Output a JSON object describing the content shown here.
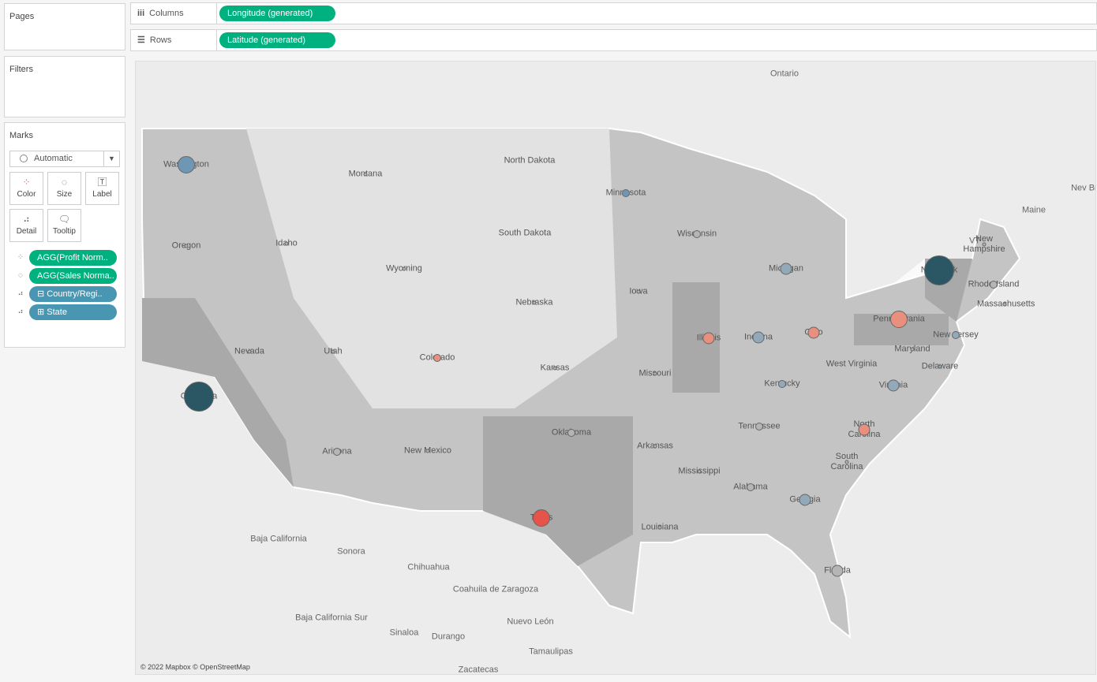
{
  "panels": {
    "pages": "Pages",
    "filters": "Filters",
    "marks": "Marks"
  },
  "shelves": {
    "columns_label": "Columns",
    "columns_pill": "Longitude (generated)",
    "rows_label": "Rows",
    "rows_pill": "Latitude (generated)"
  },
  "marks": {
    "type": "Automatic",
    "buttons": [
      {
        "label": "Color",
        "icon": "color-icon"
      },
      {
        "label": "Size",
        "icon": "size-icon"
      },
      {
        "label": "Label",
        "icon": "label-icon"
      },
      {
        "label": "Detail",
        "icon": "detail-icon"
      },
      {
        "label": "Tooltip",
        "icon": "tooltip-icon"
      }
    ],
    "fields": [
      {
        "label": "AGG(Profit Norm..",
        "kind": "color"
      },
      {
        "label": "AGG(Sales Norma..",
        "kind": "size"
      },
      {
        "label": "⊟ Country/Regi..",
        "kind": "detail"
      },
      {
        "label": "⊞ State",
        "kind": "detail"
      }
    ]
  },
  "map": {
    "attribution": "© 2022 Mapbox © OpenStreetMap",
    "colors": {
      "dark": "#2b5664",
      "blue": "#6f97b3",
      "bluegray": "#92a9ba",
      "gray": "#b5b5b5",
      "salmon": "#e8907d",
      "red": "#e5534b"
    },
    "region_labels": [
      "Ontario",
      "Maine",
      "Nev Brun",
      "VT",
      "Baja California",
      "Sonora",
      "Chihuahua",
      "Coahuila de Zaragoza",
      "Nuevo León",
      "Tamaulipas",
      "Sinaloa",
      "Durango",
      "Zacatecas",
      "Baja California Sur"
    ],
    "states": [
      {
        "name": "Washington",
        "color": "blue",
        "size": "large"
      },
      {
        "name": "Oregon",
        "color": "gray",
        "size": "tiny"
      },
      {
        "name": "Idaho",
        "color": "gray",
        "size": "tiny"
      },
      {
        "name": "Montana",
        "color": "gray",
        "size": "tiny"
      },
      {
        "name": "Wyoming",
        "color": "gray",
        "size": "tiny"
      },
      {
        "name": "Nevada",
        "color": "gray",
        "size": "tiny"
      },
      {
        "name": "Utah",
        "color": "gray",
        "size": "tiny"
      },
      {
        "name": "California",
        "color": "dark",
        "size": "xlarge"
      },
      {
        "name": "Arizona",
        "color": "gray",
        "size": "small"
      },
      {
        "name": "Colorado",
        "color": "salmon",
        "size": "small"
      },
      {
        "name": "New Mexico",
        "color": "gray",
        "size": "tiny"
      },
      {
        "name": "North Dakota"
      },
      {
        "name": "South Dakota"
      },
      {
        "name": "Nebraska",
        "color": "gray",
        "size": "tiny"
      },
      {
        "name": "Kansas",
        "color": "gray",
        "size": "tiny"
      },
      {
        "name": "Oklahoma",
        "color": "gray",
        "size": "small"
      },
      {
        "name": "Texas",
        "color": "red",
        "size": "large"
      },
      {
        "name": "Minnesota",
        "color": "blue",
        "size": "small"
      },
      {
        "name": "Iowa",
        "color": "gray",
        "size": "tiny"
      },
      {
        "name": "Missouri",
        "color": "gray",
        "size": "tiny"
      },
      {
        "name": "Arkansas",
        "color": "gray",
        "size": "tiny"
      },
      {
        "name": "Louisiana",
        "color": "gray",
        "size": "tiny"
      },
      {
        "name": "Wisconsin",
        "color": "gray",
        "size": "small"
      },
      {
        "name": "Illinois",
        "color": "salmon",
        "size": "medium"
      },
      {
        "name": "Michigan",
        "color": "bluegray",
        "size": "medium"
      },
      {
        "name": "Indiana",
        "color": "bluegray",
        "size": "medium"
      },
      {
        "name": "Ohio",
        "color": "salmon",
        "size": "medium"
      },
      {
        "name": "Kentucky",
        "color": "bluegray",
        "size": "small"
      },
      {
        "name": "Tennessee",
        "color": "gray",
        "size": "small"
      },
      {
        "name": "Mississippi",
        "color": "gray",
        "size": "tiny"
      },
      {
        "name": "Alabama",
        "color": "gray",
        "size": "small"
      },
      {
        "name": "Georgia",
        "color": "bluegray",
        "size": "medium"
      },
      {
        "name": "Florida",
        "color": "gray",
        "size": "medium"
      },
      {
        "name": "South Carolina",
        "color": "gray",
        "size": "tiny"
      },
      {
        "name": "North Carolina",
        "color": "salmon",
        "size": "medium"
      },
      {
        "name": "Virginia",
        "color": "bluegray",
        "size": "medium"
      },
      {
        "name": "West Virginia"
      },
      {
        "name": "Pennsylvania",
        "color": "salmon",
        "size": "large"
      },
      {
        "name": "New York",
        "color": "dark",
        "size": "xlarge"
      },
      {
        "name": "New Jersey",
        "color": "bluegray",
        "size": "small"
      },
      {
        "name": "Maryland",
        "color": "gray",
        "size": "tiny"
      },
      {
        "name": "Delaware",
        "color": "bluegray",
        "size": "tiny"
      },
      {
        "name": "Massachusetts",
        "color": "gray",
        "size": "tiny"
      },
      {
        "name": "Rhode Island",
        "color": "gray",
        "size": "small"
      },
      {
        "name": "New Hampshire",
        "color": "gray",
        "size": "tiny"
      }
    ]
  }
}
